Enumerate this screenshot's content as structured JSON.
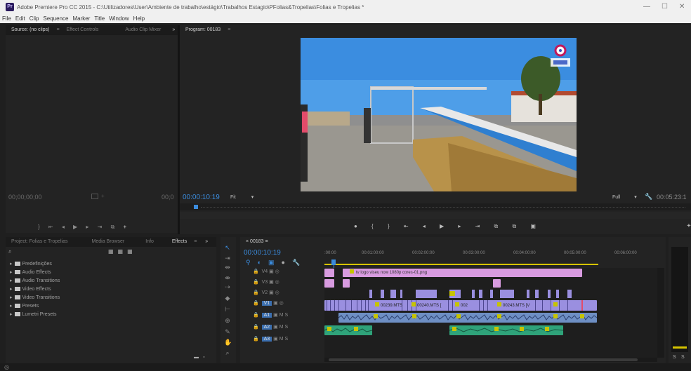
{
  "window": {
    "title": "Adobe Premiere Pro CC 2015 - C:\\Utilizadores\\User\\Ambiente de trabalho\\estágio\\Trabalhos Estagio\\PFolias&Tropelias\\Folias e Tropelias *",
    "app_icon_label": "Pr",
    "controls": {
      "minimize": "—",
      "maximize": "☐",
      "close": "✕"
    }
  },
  "menu": [
    "File",
    "Edit",
    "Clip",
    "Sequence",
    "Marker",
    "Title",
    "Window",
    "Help"
  ],
  "source_panel": {
    "tabs": [
      "Source: (no clips)",
      "≡",
      "Effect Controls",
      "Audio Clip Mixer",
      "»"
    ],
    "timecode_left": "00;00;00;00",
    "timecode_right": "00;0"
  },
  "program_panel": {
    "tab": "Program: 00183",
    "tab_menu": "≡",
    "timecode": "00:00:10:19",
    "fit": "Fit",
    "resolution": "Full",
    "duration": "00:05:23:1"
  },
  "project_panel": {
    "tabs": [
      "Project: Folias e Tropelias",
      "Media Browser",
      "Info",
      "Effects",
      "≡",
      "»"
    ],
    "search_placeholder": "",
    "items": [
      "Predefinições",
      "Audio Effects",
      "Audio Transitions",
      "Video Effects",
      "Video Transitions",
      "Presets",
      "Lumetri Presets"
    ]
  },
  "timeline": {
    "tab": "00183",
    "timecode": "00:00:10:19",
    "ruler": [
      ":00:00",
      "00:01:00:00",
      "00:02:00:00",
      "00:03:00:00",
      "00:04:00:00",
      "00:05:00:00",
      "00:06:00:00"
    ],
    "tracks": [
      {
        "name": "V4"
      },
      {
        "name": "V3"
      },
      {
        "name": "V2"
      },
      {
        "name": "V1"
      },
      {
        "name": "A1"
      },
      {
        "name": "A2"
      },
      {
        "name": "A3"
      }
    ],
    "clip_labels": {
      "logo": "tv logo viseu now 1080p cores-01.png",
      "c1": "00239.MTS",
      "c2": "00240.MTS [",
      "c3": "002",
      "c4": "00243.MTS [V"
    },
    "track_letters": {
      "mute": "M",
      "solo": "S"
    }
  },
  "meters": {
    "labels": [
      "S",
      "S"
    ]
  },
  "colors": {
    "accent": "#3b8bdc",
    "video_clip": "#9a8fe0",
    "logo_clip": "#d89be0",
    "audio_clip": "#2fa37a"
  }
}
